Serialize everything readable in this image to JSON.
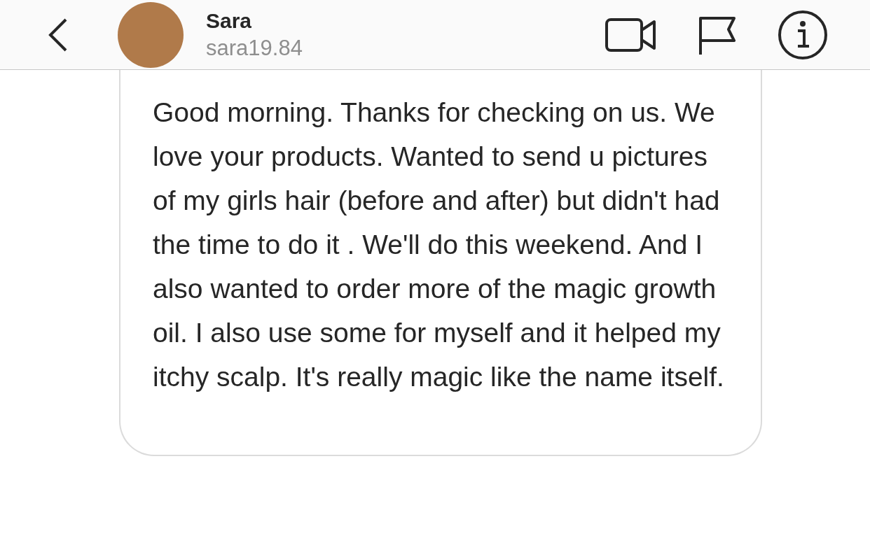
{
  "header": {
    "name": "Sara",
    "username": "sara19.84"
  },
  "message": {
    "text": "Good morning. Thanks for checking on us. We love your products. Wanted to send u pictures of my girls hair (before and after) but didn't had the time to do it . We'll do this weekend. And I also wanted to order more of the magic growth oil. I also use some for myself and it helped my itchy scalp. It's really magic like the name itself."
  }
}
